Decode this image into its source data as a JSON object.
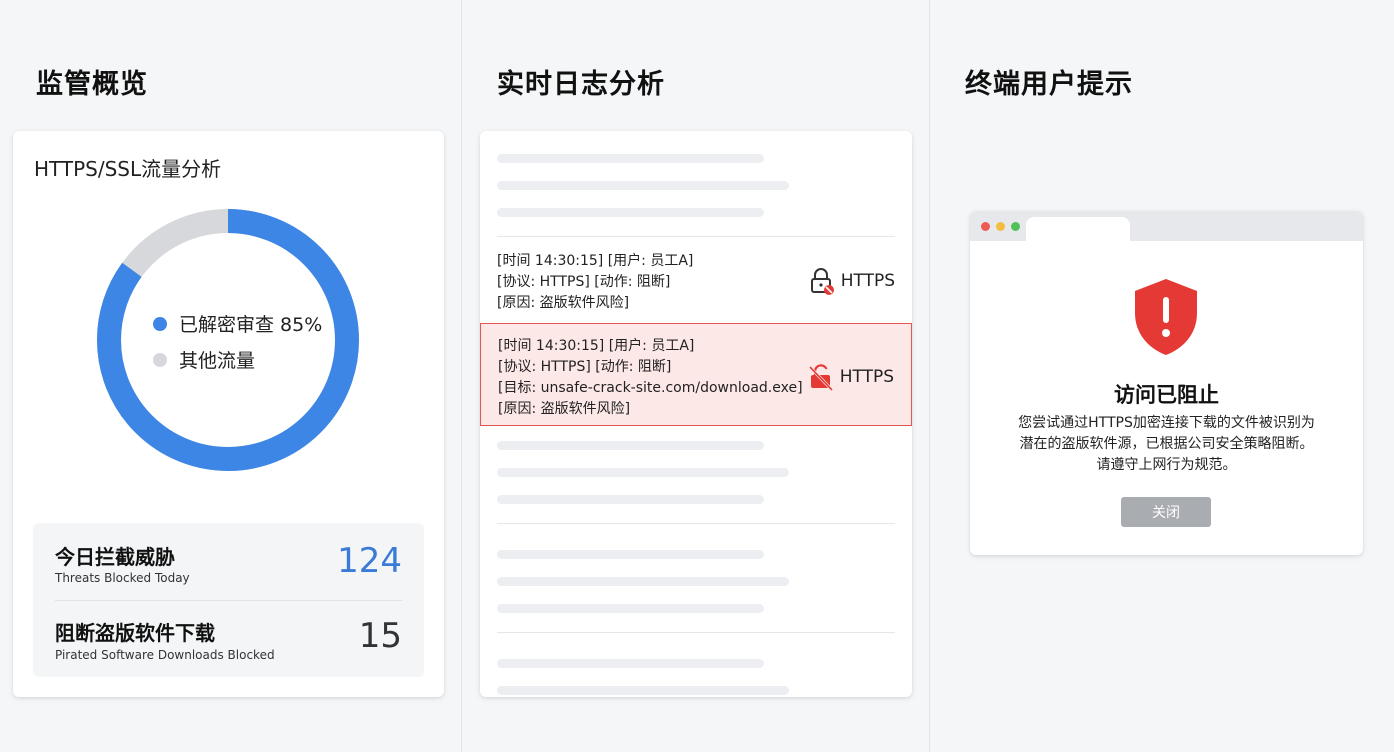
{
  "sections": {
    "overview": "监管概览",
    "logs": "实时日志分析",
    "user": "终端用户提示"
  },
  "overview": {
    "card_title": "HTTPS/SSL流量分析",
    "donut": {
      "decrypted_fraction": 0.85,
      "decrypted_color": "#3d86e5",
      "other_color": "#d6d8db"
    },
    "legend": [
      {
        "label": "已解密审查 85%",
        "color": "#3d86e5"
      },
      {
        "label": "其他流量",
        "color": "#d6d8db"
      }
    ],
    "stats": [
      {
        "label": "今日拦截威胁",
        "sub": "Threats Blocked Today",
        "value": "124",
        "color": "#3a7bd5"
      },
      {
        "label": "阻断盗版软件下载",
        "sub": "Pirated Software Downloads Blocked",
        "value": "15",
        "color": "#333333"
      }
    ]
  },
  "logs": {
    "entry1": {
      "lines": [
        "[时间 14:30:15] [用户: 员工A]",
        "[协议: HTTPS] [动作: 阻断]",
        "[原因: 盗版软件风险]"
      ],
      "protocol": "HTTPS",
      "icon": "lock-blocked-icon"
    },
    "entry2": {
      "lines": [
        "[时间 14:30:15] [用户: 员工A]",
        "[协议: HTTPS] [动作: 阻断]",
        "[目标: unsafe-crack-site.com/download.exe]",
        "[原因: 盗版软件风险]"
      ],
      "protocol": "HTTPS",
      "icon": "unlocked-slash-icon",
      "highlight_color": "#e25555"
    }
  },
  "alert": {
    "icon": "shield-warning-icon",
    "title": "访问已阻止",
    "message": [
      "您尝试通过HTTPS加密连接下载的文件被识别为",
      "潜在的盗版软件源，已根据公司安全策略阻断。",
      "请遵守上网行为规范。"
    ],
    "close_label": "关闭",
    "shield_color": "#e53935"
  }
}
